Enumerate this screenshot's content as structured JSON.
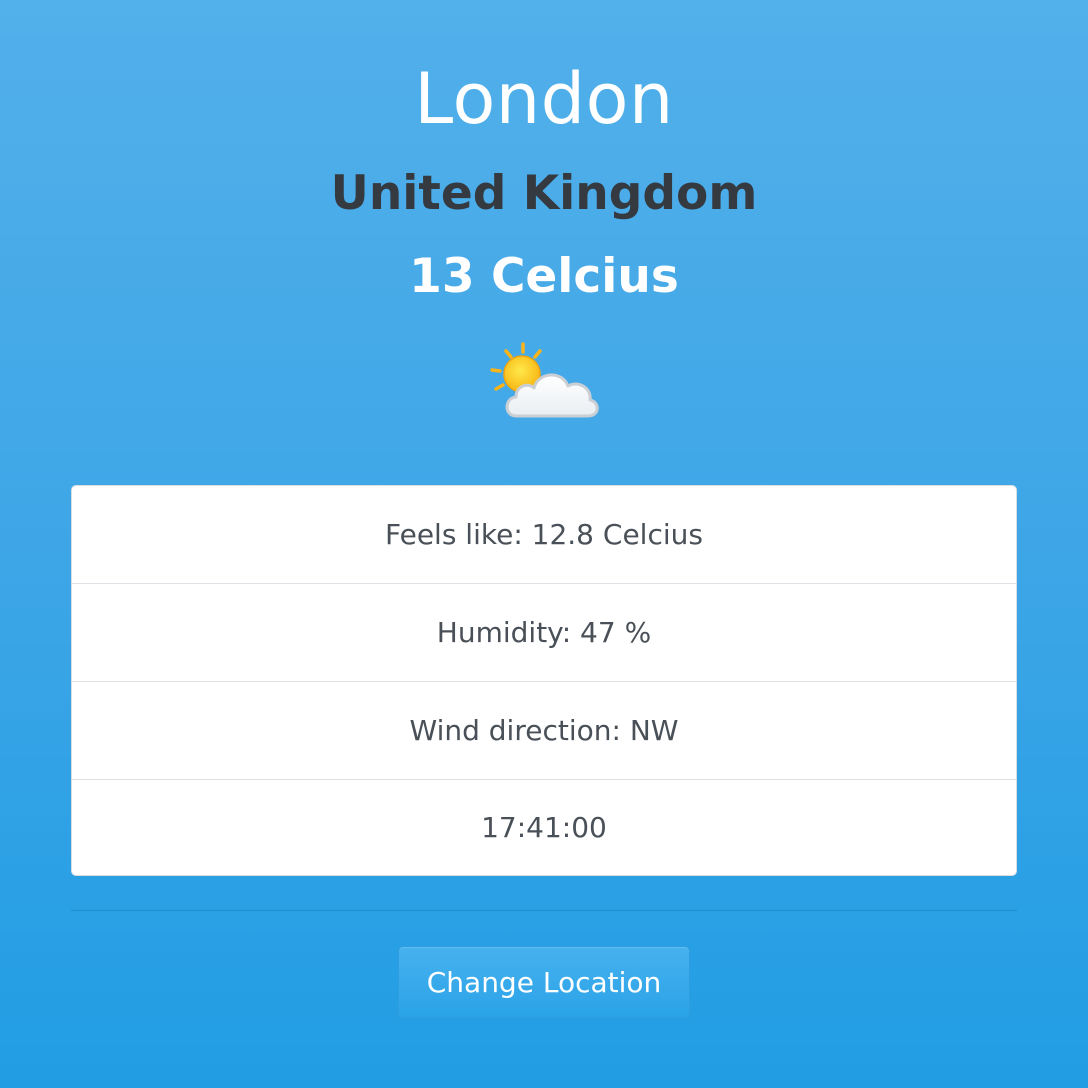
{
  "location": {
    "city": "London",
    "country": "United Kingdom",
    "temperature": "13 Celcius",
    "condition_icon": "sun-behind-cloud-icon"
  },
  "details": [
    {
      "text": "Feels like: 12.8 Celcius"
    },
    {
      "text": "Humidity: 47 %"
    },
    {
      "text": "Wind direction: NW"
    },
    {
      "text": "17:41:00"
    }
  ],
  "actions": {
    "change_location_label": "Change Location"
  },
  "colors": {
    "background_top": "#52b0ea",
    "background_bottom": "#219de4",
    "country_text": "#343a40",
    "detail_text": "#495057",
    "button": "#2ba3e8"
  }
}
